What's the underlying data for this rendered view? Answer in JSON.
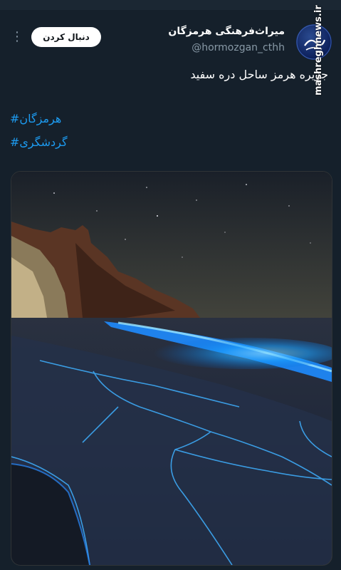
{
  "header": {
    "follow_label": "دنبال کردن",
    "more_icon": "⋮",
    "display_name": "میراث‌فرهنگی هرمزگان",
    "handle": "@hormozgan_cthh"
  },
  "tweet": {
    "text": "جزیره هرمز ساحل دره سفید",
    "hashtags": [
      "هرمزگان#",
      "گردشگری#"
    ]
  },
  "media": {
    "alt": "bioluminescent beach at night"
  },
  "watermark": {
    "text": "mashreghnews.ir"
  },
  "colors": {
    "background": "#15202b",
    "link": "#1d9bf0",
    "muted": "#8899a6"
  }
}
